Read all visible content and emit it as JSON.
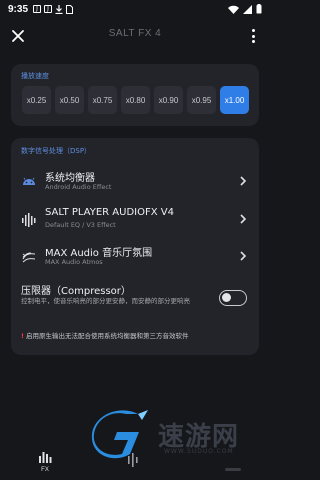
{
  "status_bar": {
    "time": "9:35",
    "icons": [
      "notification-j-icon",
      "notification-j-icon",
      "download-icon",
      "sim-icon"
    ],
    "right_icons": [
      "wifi-icon",
      "signal-icon",
      "battery-icon"
    ]
  },
  "top_bar": {
    "title": "SALT FX 4"
  },
  "speed": {
    "label": "播放速度",
    "options": [
      "x0.25",
      "x0.50",
      "x0.75",
      "x0.80",
      "x0.90",
      "x0.95",
      "x1.00"
    ],
    "selected": "x1.00"
  },
  "dsp": {
    "label": "数字信号处理（DSP）",
    "items": [
      {
        "title": "系统均衡器",
        "subtitle": "Android Audio Effect",
        "icon": "android-icon"
      },
      {
        "title": "SALT PLAYER AUDIOFX V4",
        "subtitle": "Default EQ / V3 Effect",
        "icon": "equalizer-bars-icon"
      },
      {
        "title": "MAX Audio 音乐厅氛围",
        "subtitle": "MAX Audio Atmos",
        "icon": "surround-sound-icon"
      }
    ],
    "compressor": {
      "title": "压限器（Compressor）",
      "description": "控制电平，使音乐响亮的部分更安静，而安静的部分更响亮",
      "enabled": false
    },
    "warning": "启用原生输出无法配合使用系统均衡器和第三方音效软件",
    "warning_mark": "!"
  },
  "watermark": {
    "brand": "速游网",
    "url": "WWW.SUDUO.COM"
  },
  "bottom_nav": {
    "fx_label": "FX"
  },
  "colors": {
    "background": "#16171b",
    "card": "#23242a",
    "accent": "#2f7ee8",
    "section_label": "#5f8fe0"
  }
}
